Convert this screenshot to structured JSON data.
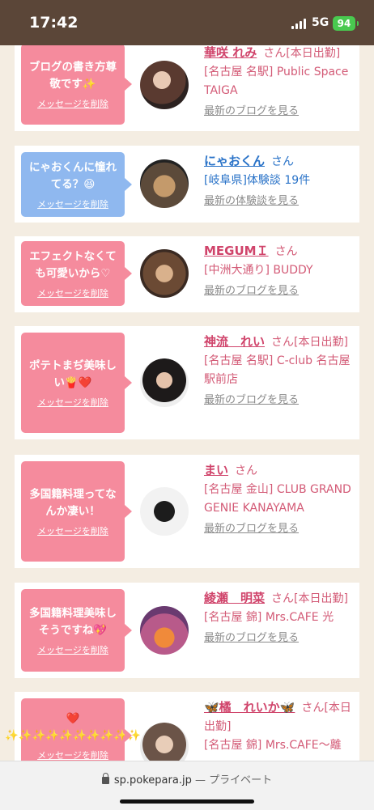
{
  "status_bar": {
    "time": "17:42",
    "network": "5G",
    "battery": "94"
  },
  "cards": [
    {
      "message": "ブログの書き方尊敬です✨",
      "delete_label": "メッセージを削除",
      "name": "華咲 れみ",
      "san": "さん[本日出勤]",
      "shop": "[名古屋 名駅] Public Space TAIGA",
      "more": "最新のブログを見る",
      "color": "pink"
    },
    {
      "message": "にゃおくんに憧れてる？😆",
      "delete_label": "メッセージを削除",
      "name": "にゃおくん",
      "san": "さん",
      "shop": "[岐阜県]体験談 19件",
      "more": "最新の体験談を見る",
      "color": "blue"
    },
    {
      "message": "エフェクトなくても可愛いから♡",
      "delete_label": "メッセージを削除",
      "name": "MEGUMＩ",
      "san": "さん",
      "shop": "[中洲大通り] BUDDY",
      "more": "最新のブログを見る",
      "color": "pink"
    },
    {
      "message": "ポテトまぢ美味しい🍟❤️",
      "delete_label": "メッセージを削除",
      "name": "神流　れい",
      "san": "さん[本日出勤]",
      "shop": "[名古屋 名駅] C-club 名古屋駅前店",
      "more": "最新のブログを見る",
      "color": "pink"
    },
    {
      "message": "多国籍料理ってなんか凄い！",
      "delete_label": "メッセージを削除",
      "name": "まい",
      "san": "さん",
      "shop": "[名古屋 金山] CLUB GRAND GENIE KANAYAMA",
      "more": "最新のブログを見る",
      "color": "pink"
    },
    {
      "message": "多国籍料理美味しそうですね💖",
      "delete_label": "メッセージを削除",
      "name": "綾瀬　明菜",
      "san": "さん[本日出勤]",
      "shop": "[名古屋 錦] Mrs.CAFE 光",
      "more": "最新のブログを見る",
      "color": "pink"
    },
    {
      "message": "❤️ ✨✨✨✨✨✨✨✨✨✨",
      "delete_label": "メッセージを削除",
      "name": "🦋橘　れいか🦋",
      "san": "さん[本日出勤]",
      "shop": "[名古屋 錦] Mrs.CAFE〜離",
      "more": "",
      "color": "pink"
    }
  ],
  "browser": {
    "url": "sp.pokepara.jp",
    "mode": "— プライベート"
  },
  "colors": {
    "accent": "#d0446b",
    "bubble_pink": "#f58b9d",
    "bubble_blue": "#8fb8ef",
    "status_bar": "#5b4638"
  }
}
